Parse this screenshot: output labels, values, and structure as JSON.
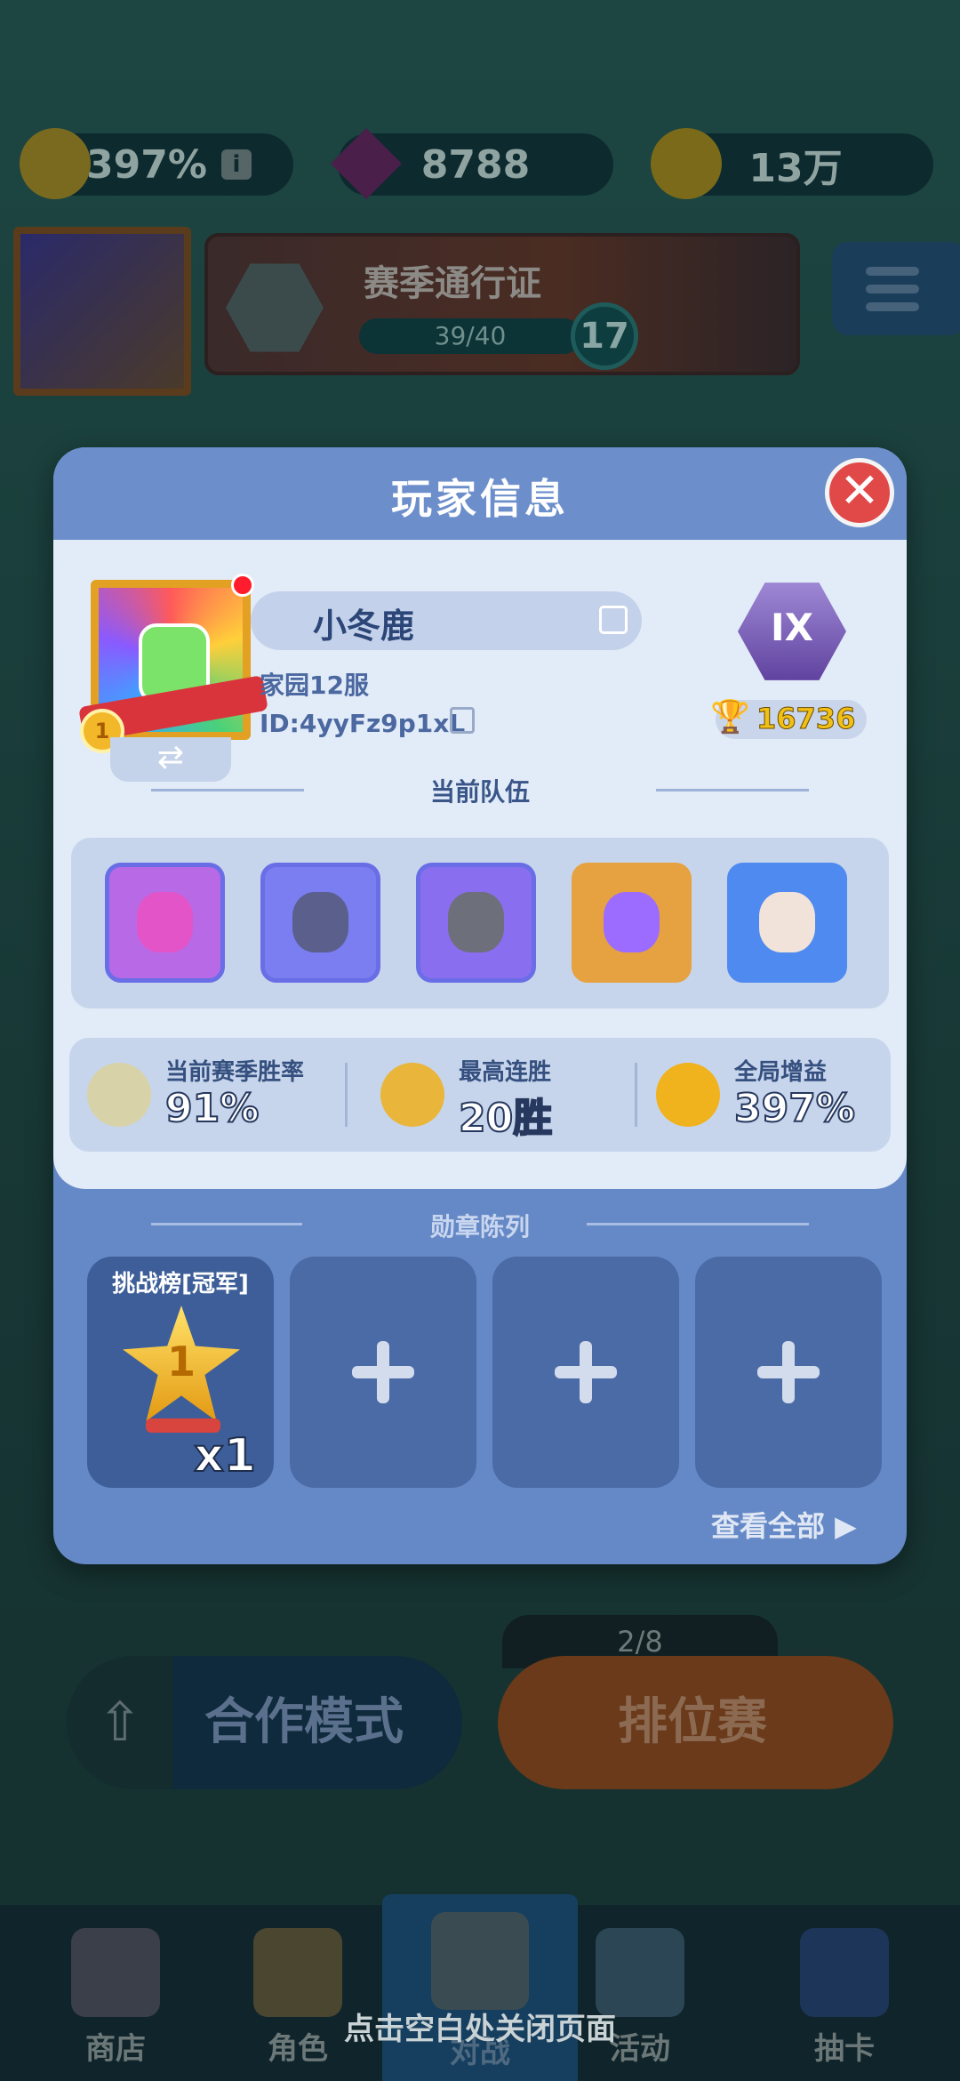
{
  "topbar": {
    "boost_value": "397%",
    "info_icon": "info-icon",
    "gems": "8788",
    "coins": "13万"
  },
  "season_pass": {
    "title": "赛季通行证",
    "progress_text": "39/40",
    "progress": 0.975,
    "level": "17"
  },
  "dialog": {
    "title": "玩家信息",
    "close_icon": "close-icon",
    "player": {
      "name": "小冬鹿",
      "server": "家园12服",
      "id": "ID:4yyFz9p1xL",
      "rank": "IX",
      "trophies": "16736"
    },
    "team_section_title": "当前队伍",
    "team": [
      {
        "icon": "hero-pink-ogre-icon",
        "color": "#e354c8"
      },
      {
        "icon": "hero-dark-knight-icon",
        "color": "#5a5f8c"
      },
      {
        "icon": "hero-armored-knight-icon",
        "color": "#6d6f7a"
      },
      {
        "icon": "hero-purple-demon-icon",
        "color": "#9b6cff"
      },
      {
        "icon": "hero-cheer-girl-icon",
        "color": "#f1e3d9"
      }
    ],
    "stats": [
      {
        "label": "当前赛季胜率",
        "value": "91%",
        "icon": "crossed-swords-icon"
      },
      {
        "label": "最高连胜",
        "value": "20胜",
        "icon": "trophy-icon"
      },
      {
        "label": "全局增益",
        "value": "397%",
        "icon": "boost-icon"
      }
    ],
    "medal_section_title": "勋章陈列",
    "medals": [
      {
        "name": "挑战榜[冠军]",
        "count": "x1",
        "icon": "champion-star-medal-icon",
        "badge": "1"
      },
      {
        "name": "",
        "icon": "plus-icon"
      },
      {
        "name": "",
        "icon": "plus-icon"
      },
      {
        "name": "",
        "icon": "plus-icon"
      }
    ],
    "view_all": "查看全部 ▶"
  },
  "modes": {
    "coop": "合作模式",
    "ranked": "排位赛",
    "ticket": "2/8"
  },
  "nav": {
    "items": [
      "商店",
      "角色",
      "对战",
      "活动",
      "抽卡"
    ]
  },
  "close_hint": "点击空白处关闭页面"
}
